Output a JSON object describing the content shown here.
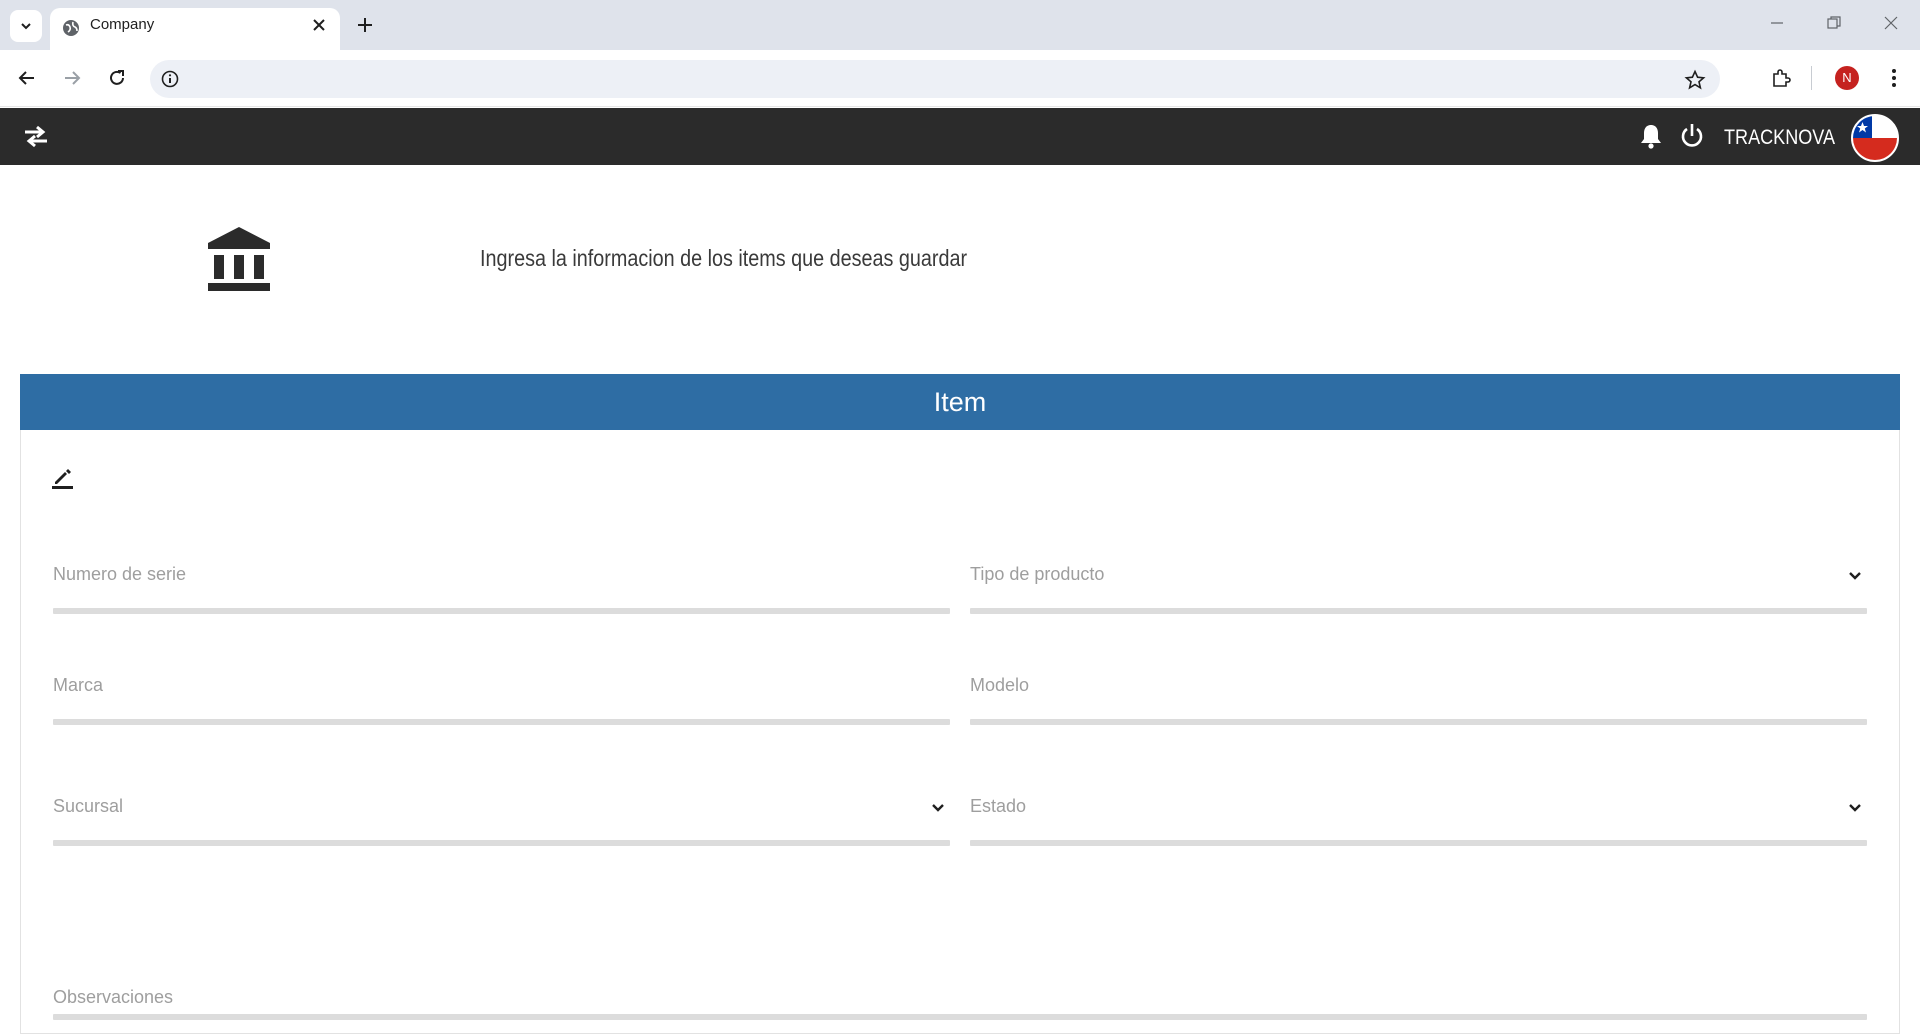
{
  "browser": {
    "tab_title": "Company",
    "url": ""
  },
  "app": {
    "brand": "TRACKNOVA",
    "intro_text": "Ingresa la informacion de los items que deseas guardar",
    "card_title": "Item",
    "profile_initial": "N"
  },
  "form": {
    "numero_de_serie": "Numero de serie",
    "tipo_de_producto": "Tipo de producto",
    "marca": "Marca",
    "modelo": "Modelo",
    "sucursal": "Sucursal",
    "estado": "Estado",
    "observaciones": "Observaciones"
  },
  "colors": {
    "appbar": "#2b2b2b",
    "card_header": "#2e6da4",
    "field_line": "#dcdcdc",
    "label": "#9e9e9e"
  },
  "icons": {
    "sidebar_toggle": "swap-arrows-icon",
    "notifications": "bell-icon",
    "logout": "power-icon",
    "language": "chile-flag-icon",
    "intro": "bank-icon",
    "edit": "edit-pencil-icon"
  }
}
